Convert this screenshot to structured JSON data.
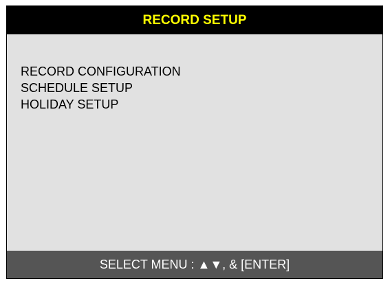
{
  "header": {
    "title": "RECORD SETUP"
  },
  "menu": {
    "items": [
      {
        "label": "RECORD CONFIGURATION"
      },
      {
        "label": "SCHEDULE SETUP"
      },
      {
        "label": "HOLIDAY SETUP"
      }
    ]
  },
  "footer": {
    "hint": "SELECT MENU : ▲▼, & [ENTER]"
  },
  "colors": {
    "header_bg": "#000000",
    "title": "#ffff00",
    "panel_bg": "#e1e1e1",
    "footer_bg": "#555555",
    "footer_text": "#ffffff"
  }
}
